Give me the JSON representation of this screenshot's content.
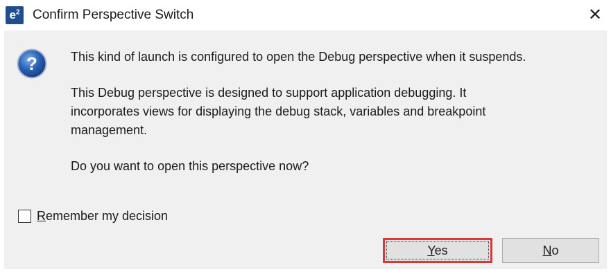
{
  "window": {
    "app_icon_text": "e²",
    "title": "Confirm Perspective Switch",
    "close_glyph": "✕"
  },
  "icons": {
    "app": "e2-studio-icon",
    "question": "question-icon",
    "close": "close-icon"
  },
  "message": {
    "line1": "This kind of launch is configured to open the Debug perspective when it suspends.",
    "paragraph2": [
      "This Debug perspective is designed to support application debugging.  It",
      "incorporates views for displaying the debug stack, variables and breakpoint",
      "management."
    ],
    "question": "Do you want to open this perspective now?"
  },
  "checkbox": {
    "mnemonic": "R",
    "label_rest": "emember my decision",
    "checked": false
  },
  "buttons": {
    "yes": {
      "mnemonic": "Y",
      "label_rest": "es",
      "highlighted": true
    },
    "no": {
      "mnemonic": "N",
      "label_rest": "o"
    }
  },
  "colors": {
    "dialog_background": "#f0f0f0",
    "highlight_border": "#d9383a",
    "button_background": "#e1e1e1",
    "question_icon_blue": "#2a63b8"
  }
}
